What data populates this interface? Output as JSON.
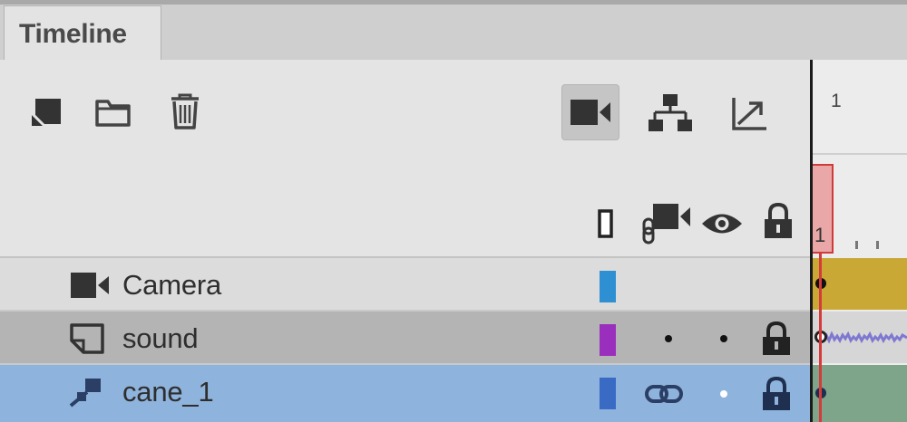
{
  "panel": {
    "tab_label": "Timeline"
  },
  "toolbar": {
    "icons": [
      "new-layer-icon",
      "new-folder-icon",
      "delete-icon",
      "camera-icon",
      "layer-parenting-icon",
      "paste-motion-icon"
    ]
  },
  "frame_ruler": {
    "top_label": "1",
    "current_frame": "1"
  },
  "column_headers": {
    "icons": [
      "outline-icon",
      "attach-to-camera-icon",
      "eye-icon",
      "lock-icon"
    ]
  },
  "layers": [
    {
      "name": "Camera",
      "icon": "camera-layer-icon",
      "color": "#2f8fd3",
      "frame_color": "#c9a836"
    },
    {
      "name": "sound",
      "icon": "layer-icon",
      "color": "#9b2fbd",
      "frame_color": "#d6d6d6",
      "attached": false,
      "visible": true,
      "locked": true
    },
    {
      "name": "cane_1",
      "icon": "parented-layer-icon",
      "color": "#3a6bc4",
      "frame_color": "#7ea48a",
      "attached": true,
      "visible": true,
      "locked": true,
      "selected": true
    }
  ]
}
